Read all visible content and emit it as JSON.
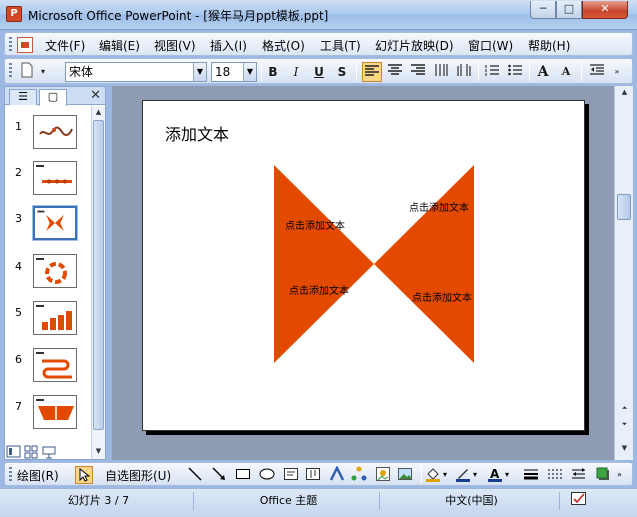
{
  "window": {
    "title": "Microsoft Office PowerPoint - [猴年马月ppt模板.ppt]",
    "min": "─",
    "max": "□",
    "close": "✕"
  },
  "menu": [
    "文件(F)",
    "编辑(E)",
    "视图(V)",
    "插入(I)",
    "格式(O)",
    "工具(T)",
    "幻灯片放映(D)",
    "窗口(W)",
    "帮助(H)"
  ],
  "toolbar": {
    "font": "宋体",
    "size": "18",
    "bold": "B",
    "italic": "I",
    "underline": "U",
    "shadow": "S",
    "grow": "A",
    "shrink": "A"
  },
  "panel": {
    "tab_outline": "☰",
    "tab_slides": "▢",
    "close": "✕"
  },
  "slides": [
    {
      "num": "1"
    },
    {
      "num": "2"
    },
    {
      "num": "3"
    },
    {
      "num": "4"
    },
    {
      "num": "5"
    },
    {
      "num": "6"
    },
    {
      "num": "7"
    }
  ],
  "selected_slide": 3,
  "slide": {
    "title": "添加文本",
    "labels": [
      "点击添加文本",
      "点击添加文本",
      "点击添加文本",
      "点击添加文本"
    ]
  },
  "drawbar": {
    "draw": "绘图(R)",
    "autoshapes": "自选图形(U)"
  },
  "status": {
    "slide": "幻灯片 3 / 7",
    "theme": "Office 主题",
    "lang": "中文(中国)"
  },
  "colors": {
    "accent": "#e34a00",
    "title_bar": "#b4d0f0"
  }
}
